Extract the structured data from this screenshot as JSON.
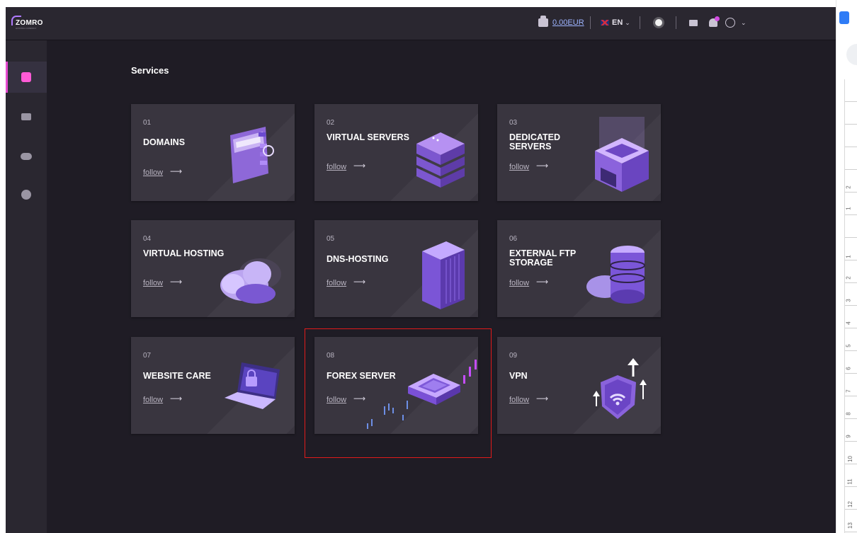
{
  "topbar": {
    "logo_text": "ZOMRO",
    "logo_sub": "HOSTING COMPANY",
    "balance": "0.00EUR",
    "language": "EN",
    "chevron": "⌄"
  },
  "page": {
    "title": "Services"
  },
  "cards": [
    {
      "num": "01",
      "title": "DOMAINS",
      "link": "follow",
      "arrow": "⟶"
    },
    {
      "num": "02",
      "title": "VIRTUAL SERVERS",
      "link": "follow",
      "arrow": "⟶"
    },
    {
      "num": "03",
      "title": "DEDICATED SERVERS",
      "link": "follow",
      "arrow": "⟶"
    },
    {
      "num": "04",
      "title": "VIRTUAL HOSTING",
      "link": "follow",
      "arrow": "⟶"
    },
    {
      "num": "05",
      "title": "DNS-HOSTING",
      "link": "follow",
      "arrow": "⟶"
    },
    {
      "num": "06",
      "title": "EXTERNAL FTP STORAGE",
      "link": "follow",
      "arrow": "⟶"
    },
    {
      "num": "07",
      "title": "WEBSITE CARE",
      "link": "follow",
      "arrow": "⟶"
    },
    {
      "num": "08",
      "title": "FOREX SERVER",
      "link": "follow",
      "arrow": "⟶"
    },
    {
      "num": "09",
      "title": "VPN",
      "link": "follow",
      "arrow": "⟶"
    }
  ],
  "sidebar": {
    "items": [
      {
        "icon": "box-icon",
        "active": true
      },
      {
        "icon": "wallet-icon",
        "active": false
      },
      {
        "icon": "users-icon",
        "active": false
      },
      {
        "icon": "support-icon",
        "active": false
      }
    ]
  },
  "ruler": [
    "2",
    "1",
    "1",
    "2",
    "3",
    "4",
    "5",
    "6",
    "7",
    "8",
    "9",
    "10",
    "11",
    "12",
    "13"
  ],
  "colors": {
    "background": "#1f1c25",
    "card": "#39353f",
    "accent": "#e64bd0",
    "highlight": "#e01b1b"
  }
}
